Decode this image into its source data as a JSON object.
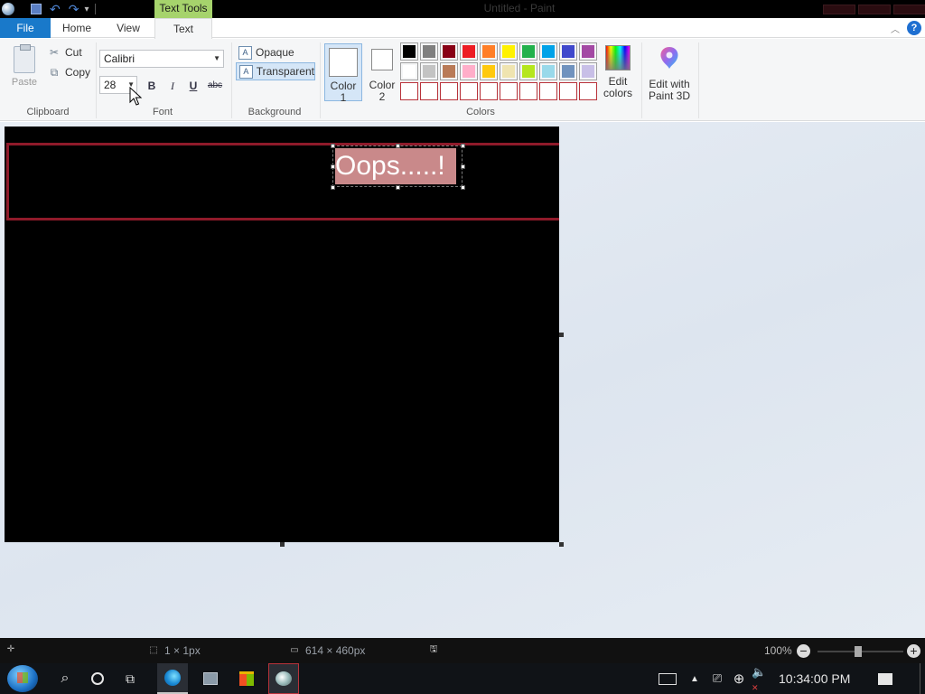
{
  "window": {
    "title": "Untitled - Paint",
    "contextual_tab": "Text Tools"
  },
  "tabs": {
    "file": "File",
    "home": "Home",
    "view": "View",
    "text": "Text"
  },
  "clipboard": {
    "paste": "Paste",
    "cut": "Cut",
    "copy": "Copy",
    "group_label": "Clipboard"
  },
  "font": {
    "family": "Calibri",
    "size": "28",
    "group_label": "Font",
    "bold": "B",
    "italic": "I",
    "underline": "U",
    "strike": "abc"
  },
  "background": {
    "opaque": "Opaque",
    "transparent": "Transparent",
    "group_label": "Background"
  },
  "colors": {
    "color1_label": "Color\n1",
    "color2_label": "Color\n2",
    "color1_value": "#ffffff",
    "color2_value": "#ffffff",
    "edit_colors": "Edit\ncolors",
    "edit_paint3d": "Edit with\nPaint 3D",
    "group_label": "Colors",
    "palette_row1": [
      "#000000",
      "#7f7f7f",
      "#880015",
      "#ed1c24",
      "#ff7f27",
      "#fff200",
      "#22b14c",
      "#00a2e8",
      "#3f48cc",
      "#a349a4"
    ],
    "palette_row2": [
      "#ffffff",
      "#c3c3c3",
      "#b97a57",
      "#ffaec9",
      "#ffc90e",
      "#efe4b0",
      "#b5e61d",
      "#99d9ea",
      "#7092be",
      "#c8bfe7"
    ]
  },
  "canvas": {
    "text": "Oops.....!",
    "background": "#000000",
    "band_color": "#8f1a2a",
    "highlight": "#c9898a"
  },
  "status": {
    "cursor_pos": "",
    "selection_size": "1 × 1px",
    "image_size": "614 × 460px",
    "zoom": "100%"
  },
  "taskbar": {
    "time": "10:34:00 PM"
  }
}
